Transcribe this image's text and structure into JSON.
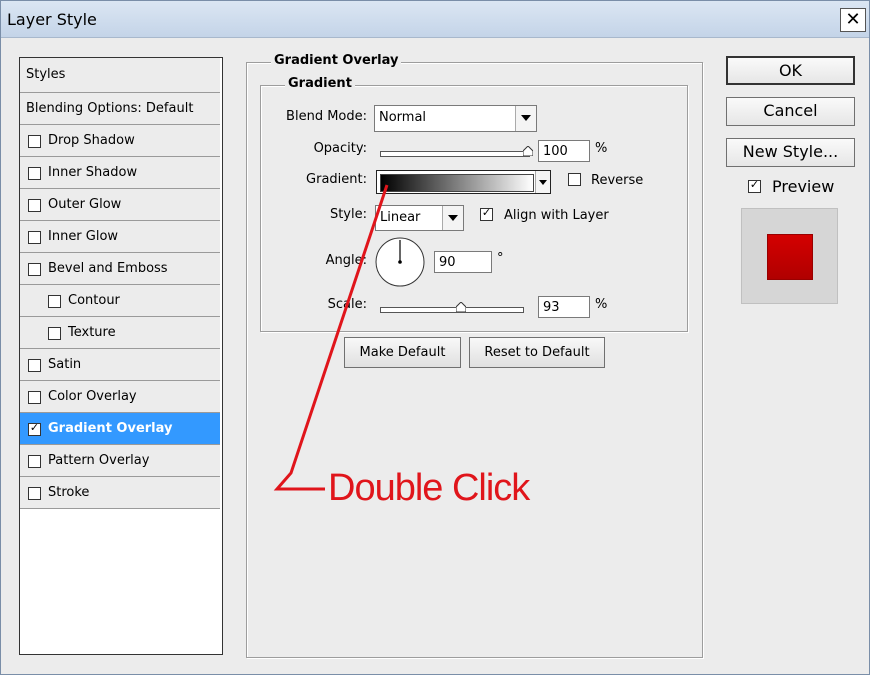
{
  "title": "Layer Style",
  "close_glyph": "✕",
  "left_panel": {
    "header": "Styles",
    "blending": "Blending Options: Default",
    "items": [
      {
        "label": "Drop Shadow",
        "checked": false
      },
      {
        "label": "Inner Shadow",
        "checked": false
      },
      {
        "label": "Outer Glow",
        "checked": false
      },
      {
        "label": "Inner Glow",
        "checked": false
      },
      {
        "label": "Bevel and Emboss",
        "checked": false
      },
      {
        "label": "Contour",
        "checked": false
      },
      {
        "label": "Texture",
        "checked": false
      },
      {
        "label": "Satin",
        "checked": false
      },
      {
        "label": "Color Overlay",
        "checked": false
      },
      {
        "label": "Gradient Overlay",
        "checked": true,
        "selected": true
      },
      {
        "label": "Pattern Overlay",
        "checked": false
      },
      {
        "label": "Stroke",
        "checked": false
      }
    ]
  },
  "panel": {
    "title": "Gradient Overlay",
    "subtitle": "Gradient",
    "blend_mode_label": "Blend Mode:",
    "blend_mode_value": "Normal",
    "opacity_label": "Opacity:",
    "opacity_value": "100",
    "opacity_unit": "%",
    "opacity_level": 1.0,
    "gradient_label": "Gradient:",
    "reverse_label": "Reverse",
    "reverse_checked": false,
    "style_label": "Style:",
    "style_value": "Linear",
    "align_label": "Align with Layer",
    "align_checked": true,
    "angle_label": "Angle:",
    "angle_value": "90",
    "angle_unit": "°",
    "scale_label": "Scale:",
    "scale_value": "93",
    "scale_unit": "%",
    "scale_level": 0.57,
    "make_default": "Make Default",
    "reset_default": "Reset to Default"
  },
  "actions": {
    "ok": "OK",
    "cancel": "Cancel",
    "new_style": "New Style...",
    "preview_label": "Preview",
    "preview_checked": true
  },
  "annotation": {
    "text": "Double Click",
    "color": "#e0151b"
  },
  "colors": {
    "selection": "#3399ff",
    "preview_swatch": "#d40000"
  }
}
